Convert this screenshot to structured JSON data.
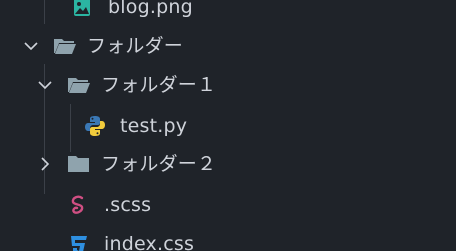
{
  "explorer": {
    "items": [
      {
        "label": "blog.png",
        "icon": "image-file-icon",
        "expandable": false
      },
      {
        "label": "フォルダー",
        "icon": "folder-open-icon",
        "expandable": true,
        "expanded": true
      },
      {
        "label": "フォルダー１",
        "icon": "folder-open-icon",
        "expandable": true,
        "expanded": true
      },
      {
        "label": "test.py",
        "icon": "python-file-icon",
        "expandable": false
      },
      {
        "label": "フォルダー２",
        "icon": "folder-closed-icon",
        "expandable": true,
        "expanded": false
      },
      {
        "label": ".scss",
        "icon": "sass-file-icon",
        "expandable": false
      },
      {
        "label": "index.css",
        "icon": "css-file-icon",
        "expandable": false
      }
    ]
  },
  "colors": {
    "background": "#1f2329",
    "text": "#cfd3da",
    "folder": "#8fa3ad",
    "python_blue": "#3a78b5",
    "python_yellow": "#f2cc3c",
    "sass": "#d04f83",
    "css": "#2e8fe0",
    "image": "#2bb5a2"
  }
}
